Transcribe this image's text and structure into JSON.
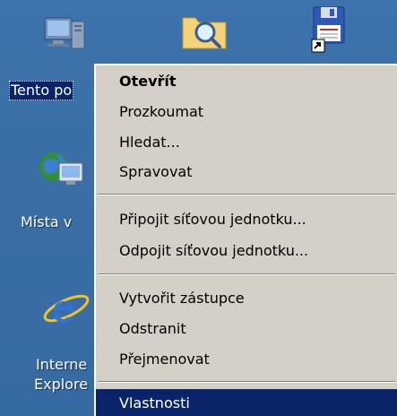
{
  "desktop": {
    "icons": [
      {
        "label": "Tento po",
        "icon": "my-computer-icon",
        "selected": true
      },
      {
        "label": "Místa v",
        "icon": "network-places-icon"
      },
      {
        "label": "Interne\nExplore",
        "line1": "Interne",
        "line2": "Explore",
        "icon": "internet-explorer-icon"
      },
      {
        "icon": "search-folder-icon"
      },
      {
        "icon": "floppy-shortcut-icon"
      }
    ]
  },
  "context_menu": {
    "items": [
      {
        "label": "Otevřít",
        "default": true
      },
      {
        "label": "Prozkoumat"
      },
      {
        "label": "Hledat..."
      },
      {
        "label": "Spravovat"
      },
      {
        "label": "Připojit síťovou jednotku..."
      },
      {
        "label": "Odpojit síťovou jednotku..."
      },
      {
        "label": "Vytvořit zástupce"
      },
      {
        "label": "Odstranit"
      },
      {
        "label": "Přejmenovat"
      },
      {
        "label": "Vlastnosti",
        "highlighted": true
      }
    ]
  },
  "colors": {
    "desktop_bg": "#3a6ea5",
    "menu_bg": "#d4d0c8",
    "highlight": "#0a246a",
    "highlight_text": "#ffffff"
  }
}
